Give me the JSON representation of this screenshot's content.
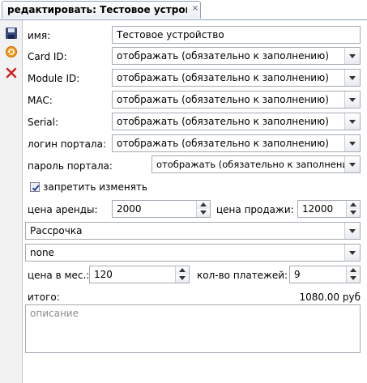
{
  "tab": {
    "title": "редактировать: Тестовое устройство",
    "close_glyph": "×"
  },
  "toolbar": {
    "save": "save-icon",
    "refresh": "refresh-icon",
    "delete": "delete-icon"
  },
  "colors": {
    "tab_border": "#8da2bd",
    "save_icon": "#3a4a7a",
    "refresh_icon": "#e07b00",
    "delete_icon": "#d02020"
  },
  "form": {
    "name": {
      "label": "имя:",
      "value": "Тестовое устройство"
    },
    "card_id": {
      "label": "Card ID:",
      "value": "отображать (обязательно к заполнению)"
    },
    "module_id": {
      "label": "Module ID:",
      "value": "отображать (обязательно к заполнению)"
    },
    "mac": {
      "label": "MAC:",
      "value": "отображать (обязательно к заполнению)"
    },
    "serial": {
      "label": "Serial:",
      "value": "отображать (обязательно к заполнению)"
    },
    "portal_login": {
      "label": "логин портала:",
      "value": "отображать (обязательно к заполнению)"
    },
    "portal_password": {
      "label": "пароль портала:",
      "value": "отображать (обязательно к заполнению)"
    },
    "forbid_edit": {
      "label": "запретить изменять",
      "checked": true
    },
    "rent_price": {
      "label": "цена аренды:",
      "value": "2000"
    },
    "sale_price": {
      "label": "цена продажи:",
      "value": "12000"
    },
    "payment_type": {
      "value": "Рассрочка"
    },
    "extra": {
      "value": "none"
    },
    "monthly_price": {
      "label": "цена в мес.:",
      "value": "120"
    },
    "payments_count": {
      "label": "кол-во платежей:",
      "value": "9"
    },
    "total": {
      "label": "итого:",
      "value": "1080.00 руб"
    },
    "description": {
      "placeholder": "описание"
    }
  }
}
